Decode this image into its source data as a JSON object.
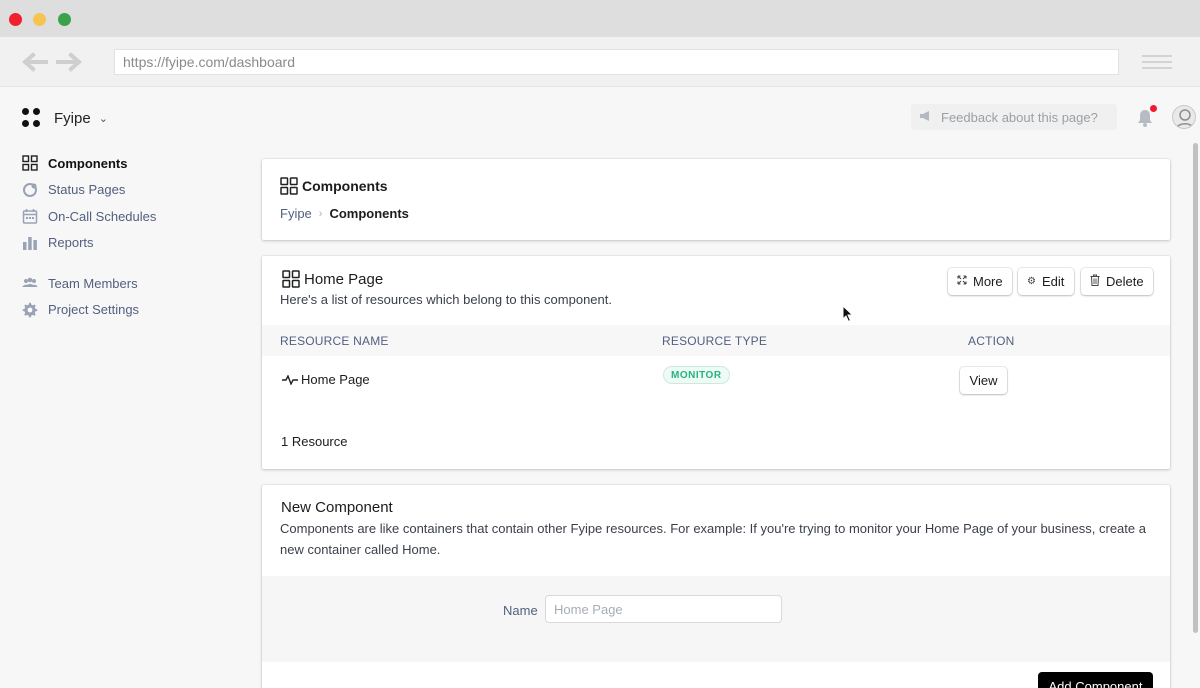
{
  "browser": {
    "url": "https://fyipe.com/dashboard"
  },
  "app": {
    "project_name": "Fyipe",
    "feedback_placeholder": "Feedback about this page?"
  },
  "sidebar": {
    "items": [
      {
        "label": "Components",
        "icon": "grid-icon"
      },
      {
        "label": "Status Pages",
        "icon": "status-icon"
      },
      {
        "label": "On-Call Schedules",
        "icon": "calendar-icon"
      },
      {
        "label": "Reports",
        "icon": "bar-chart-icon"
      },
      {
        "label": "Team Members",
        "icon": "team-icon"
      },
      {
        "label": "Project Settings",
        "icon": "gear-icon"
      }
    ]
  },
  "header": {
    "title": "Components",
    "breadcrumb": [
      "Fyipe",
      "Components"
    ]
  },
  "component": {
    "title": "Home Page",
    "description": "Here's a list of resources which belong to this component.",
    "buttons": {
      "more": "More",
      "edit": "Edit",
      "delete": "Delete"
    },
    "table": {
      "columns": [
        "RESOURCE NAME",
        "RESOURCE TYPE",
        "ACTION"
      ],
      "rows": [
        {
          "name": "Home Page",
          "type": "MONITOR",
          "action": "View"
        }
      ]
    },
    "count": "1 Resource"
  },
  "new_component": {
    "title": "New Component",
    "description": "Components are like containers that contain other Fyipe resources. For example: If you're trying to monitor your Home Page of your business, create a new container called Home.",
    "name_label": "Name",
    "name_placeholder": "Home Page",
    "submit_label": "Add Component"
  },
  "colors": {
    "accent_green": "#24b47e",
    "notification_red": "#ef1c2d"
  }
}
